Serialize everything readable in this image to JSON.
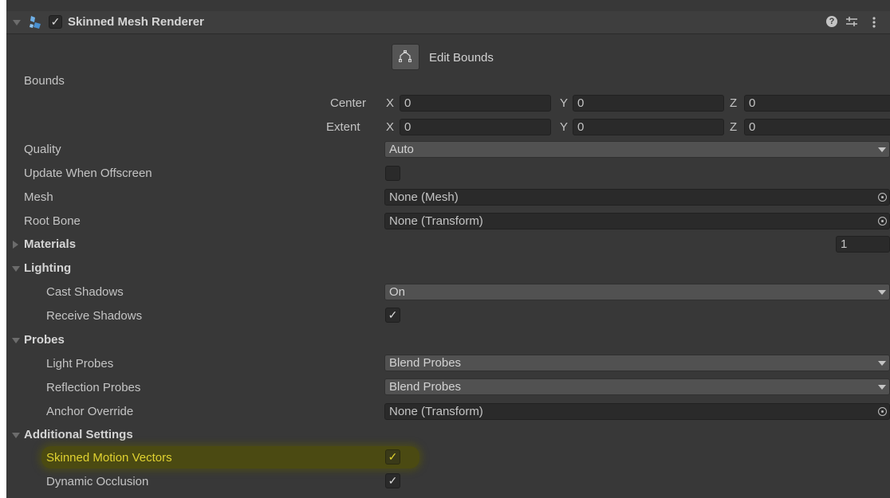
{
  "header": {
    "title": "Skinned Mesh Renderer",
    "enabled": true,
    "icons": [
      "foldout-arrow-icon",
      "mesh-renderer-icon",
      "help-icon",
      "presets-icon",
      "kebab-menu-icon"
    ]
  },
  "edit_bounds": {
    "label": "Edit Bounds"
  },
  "bounds": {
    "label": "Bounds",
    "center": {
      "label": "Center",
      "x": "0",
      "y": "0",
      "z": "0"
    },
    "extent": {
      "label": "Extent",
      "x": "0",
      "y": "0",
      "z": "0"
    },
    "axis_labels": {
      "x": "X",
      "y": "Y",
      "z": "Z"
    }
  },
  "quality": {
    "label": "Quality",
    "value": "Auto"
  },
  "update_offscreen": {
    "label": "Update When Offscreen",
    "checked": false
  },
  "mesh": {
    "label": "Mesh",
    "value": "None (Mesh)"
  },
  "root_bone": {
    "label": "Root Bone",
    "value": "None (Transform)"
  },
  "materials": {
    "label": "Materials",
    "count": "1"
  },
  "lighting": {
    "label": "Lighting",
    "cast_shadows": {
      "label": "Cast Shadows",
      "value": "On"
    },
    "receive_shadows": {
      "label": "Receive Shadows",
      "checked": true
    }
  },
  "probes": {
    "label": "Probes",
    "light_probes": {
      "label": "Light Probes",
      "value": "Blend Probes"
    },
    "reflection_probes": {
      "label": "Reflection Probes",
      "value": "Blend Probes"
    },
    "anchor_override": {
      "label": "Anchor Override",
      "value": "None (Transform)"
    }
  },
  "additional": {
    "label": "Additional Settings",
    "skinned_motion_vectors": {
      "label": "Skinned Motion Vectors",
      "checked": true
    },
    "dynamic_occlusion": {
      "label": "Dynamic Occlusion",
      "checked": true
    }
  },
  "colors": {
    "panel_bg": "#383838",
    "field_bg": "#2a2a2a",
    "dropdown_bg": "#515151",
    "highlight_bg": "#4b4a12",
    "highlight_text": "#e0d230"
  }
}
